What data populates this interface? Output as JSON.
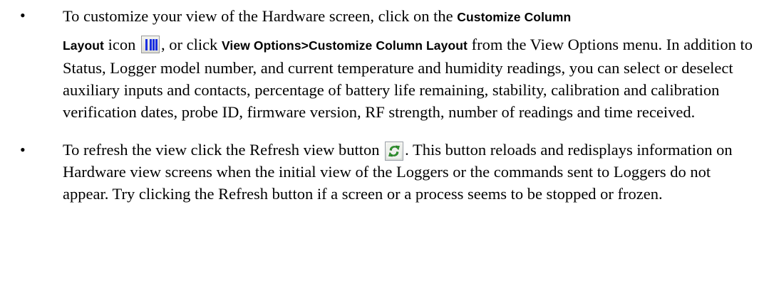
{
  "bullet_symbol": "•",
  "items": [
    {
      "t1": "To customize your view of the Hardware screen, click on the ",
      "b1": "Customize Column",
      "b2": "Layout",
      "t2": " icon ",
      "icon": "column-layout-icon",
      "t3": ", or click ",
      "b3": "View Options>Customize Column Layout",
      "t4": " from the View Options menu. In addition to Status, Logger model number, and current temperature and humidity readings, you can select or deselect auxiliary inputs and contacts, percentage of battery life remaining, stability, calibration and calibration verification dates, probe ID, firmware version, RF strength, number of readings and time received."
    },
    {
      "t1": "To refresh the view click the Refresh view button ",
      "icon": "refresh-icon",
      "t2": ". This button reloads and redisplays information on Hardware view screens when the initial view of the Loggers or the commands sent to Loggers do not appear. Try clicking the Refresh button if a screen or a process seems to be stopped or frozen."
    }
  ]
}
